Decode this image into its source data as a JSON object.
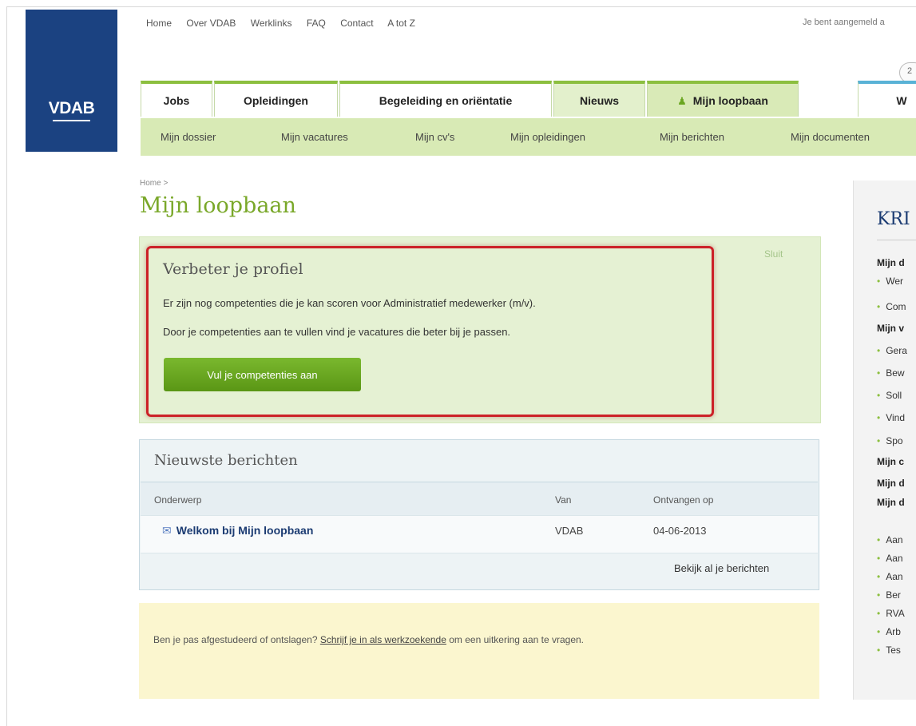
{
  "logo": {
    "text": "VDAB"
  },
  "topnav": [
    "Home",
    "Over VDAB",
    "Werklinks",
    "FAQ",
    "Contact",
    "A tot Z"
  ],
  "logged_in_text": "Je bent aangemeld a",
  "circle_button": "2",
  "tabs": [
    "Jobs",
    "Opleidingen",
    "Begeleiding en oriëntatie",
    "Nieuws",
    "Mijn loopbaan",
    "W"
  ],
  "subnav": [
    "Mijn dossier",
    "Mijn vacatures",
    "Mijn cv's",
    "Mijn opleidingen",
    "Mijn berichten",
    "Mijn documenten"
  ],
  "breadcrumb": "Home >",
  "page_title": "Mijn loopbaan",
  "promo": {
    "close": "Sluit",
    "title": "Verbeter je profiel",
    "line1": "Er zijn nog competenties die je kan scoren voor Administratief medewerker (m/v).",
    "line2": "Door je competenties aan te vullen vind je vacatures die beter bij je passen.",
    "button": "Vul je competenties aan"
  },
  "messages": {
    "title": "Nieuwste berichten",
    "columns": [
      "Onderwerp",
      "Van",
      "Ontvangen op"
    ],
    "rows": [
      {
        "subject": "Welkom bij Mijn loopbaan",
        "from": "VDAB",
        "date": "04-06-2013"
      }
    ],
    "view_all": "Bekijk al je berichten"
  },
  "notice": {
    "before": "Ben je pas afgestudeerd of ontslagen? ",
    "link": "Schrijf je in als werkzoekende",
    "after": " om een uitkering aan te vragen."
  },
  "sidebar": {
    "title": "KRI",
    "items": [
      "Mijn d",
      "Wer",
      "Com",
      "Mijn v",
      "Gera",
      "Bew",
      "Soll",
      "Vind",
      "Spo",
      "Mijn c",
      "Mijn d",
      "Mijn d",
      "Aan",
      "Aan",
      "Aan",
      "Ber",
      "RVA",
      "Arb",
      "Tes"
    ]
  },
  "colors": {
    "brand_blue": "#1b4281",
    "accent_green": "#8cbf3f",
    "highlight_red": "#cc2128"
  }
}
